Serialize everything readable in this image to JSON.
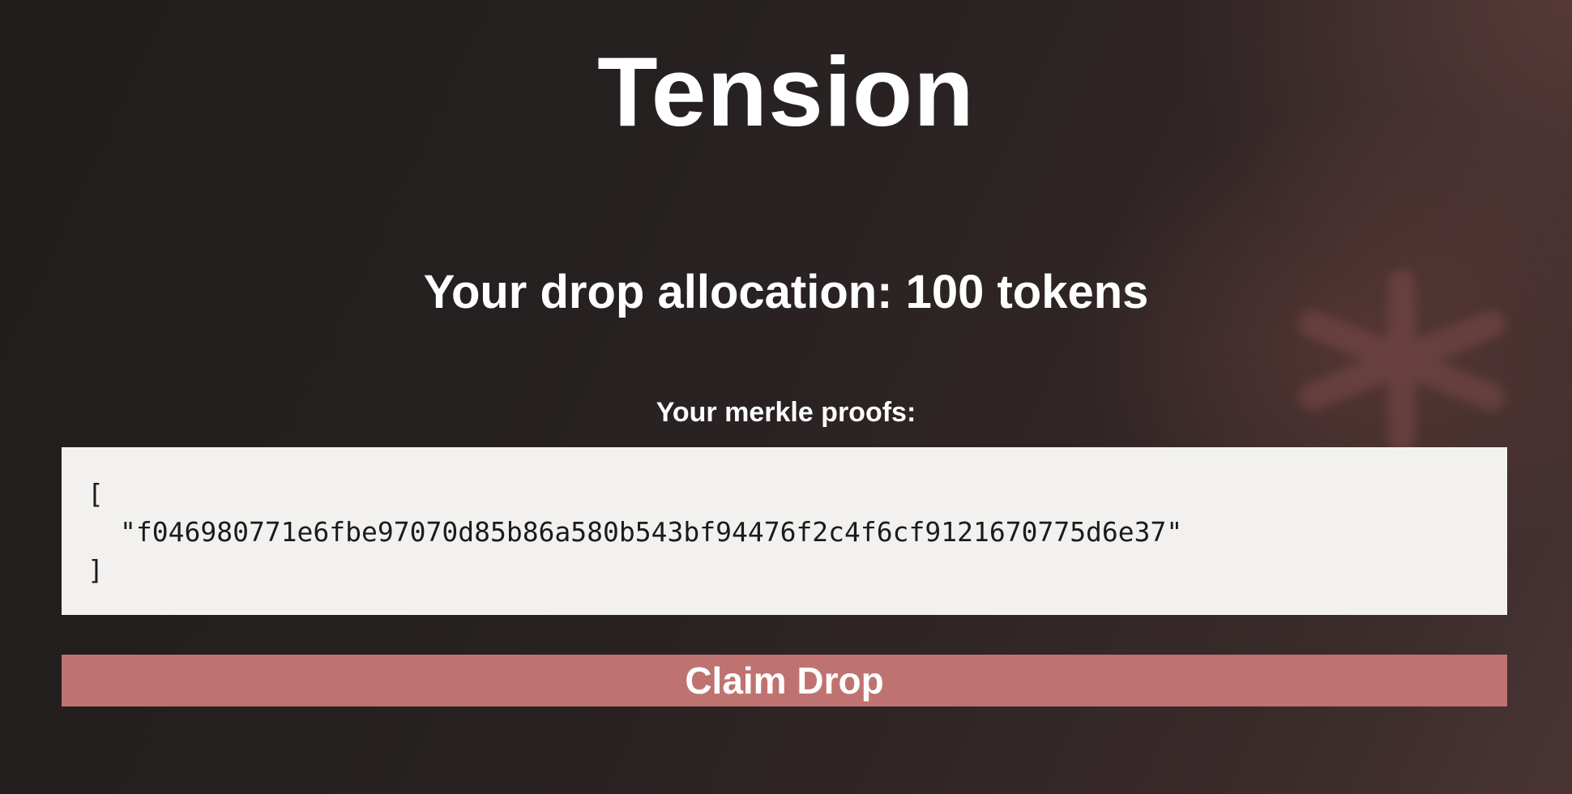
{
  "app": {
    "title": "Tension"
  },
  "allocation": {
    "text": "Your drop allocation: 100 tokens"
  },
  "proofs": {
    "label": "Your merkle proofs:",
    "open_bracket": "[",
    "items": [
      "\"f046980771e6fbe97070d85b86a580b543bf94476f2c4f6cf9121670775d6e37\""
    ],
    "close_bracket": "]"
  },
  "actions": {
    "claim_label": "Claim Drop"
  },
  "colors": {
    "button_bg": "#be7370",
    "proof_box_bg": "#f2f1ef",
    "text_primary": "#ffffff",
    "background_dark": "#221e1e"
  },
  "icons": {
    "background_decoration": "asterisk-decoration-icon"
  }
}
